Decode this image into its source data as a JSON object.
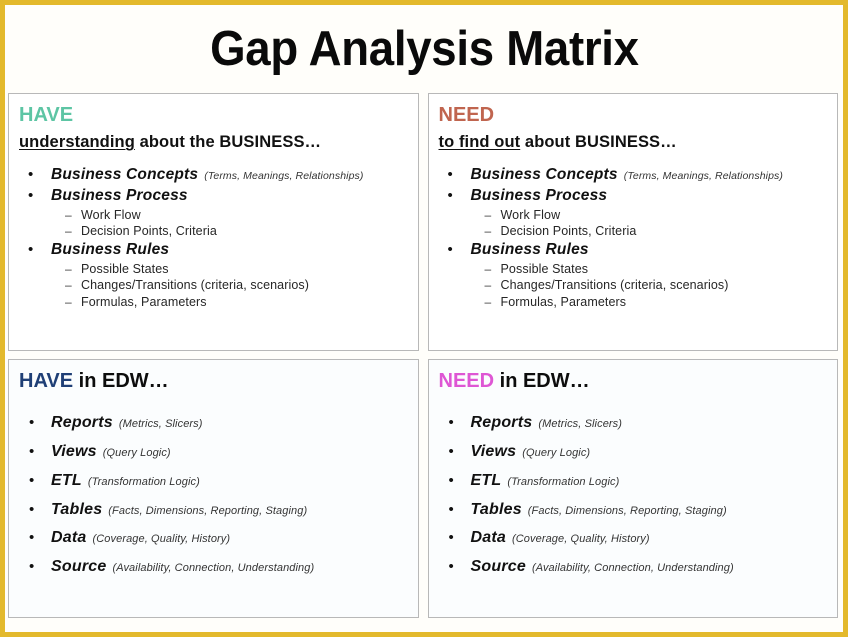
{
  "title": "Gap Analysis Matrix",
  "colors": {
    "frame": "#e3b92c",
    "have_top": "#5dc5a4",
    "need_top": "#c0654f",
    "have_edw": "#1f3f76",
    "need_edw": "#de56d4",
    "body_text": "#111111",
    "panel_border": "#b8b8b8"
  },
  "panels": {
    "have_business": {
      "keyword": "HAVE",
      "title_rest": "",
      "subtitle_underlined": "understanding",
      "subtitle_rest": "about the BUSINESS…",
      "items": [
        {
          "heading": "Business Concepts",
          "note": "(Terms,  Meanings,  Relationships)",
          "subitems": []
        },
        {
          "heading": "Business Process",
          "note": "",
          "subitems": [
            "Work Flow",
            "Decision Points, Criteria"
          ]
        },
        {
          "heading": "Business Rules",
          "note": "",
          "subitems": [
            "Possible States",
            "Changes/Transitions (criteria, scenarios)",
            "Formulas,  Parameters"
          ]
        }
      ]
    },
    "need_business": {
      "keyword": "NEED",
      "title_rest": "",
      "subtitle_underlined": "to find out",
      "subtitle_rest": "about  BUSINESS…",
      "items": [
        {
          "heading": "Business Concepts",
          "note": "(Terms,  Meanings,  Relationships)",
          "subitems": []
        },
        {
          "heading": "Business Process",
          "note": "",
          "subitems": [
            "Work Flow",
            "Decision Points, Criteria"
          ]
        },
        {
          "heading": "Business Rules",
          "note": "",
          "subitems": [
            "Possible States",
            "Changes/Transitions (criteria, scenarios)",
            "Formulas,  Parameters"
          ]
        }
      ]
    },
    "have_edw": {
      "keyword": "HAVE",
      "title_rest": " in EDW…",
      "items": [
        {
          "heading": "Reports",
          "note": "(Metrics, Slicers)"
        },
        {
          "heading": "Views",
          "note": "(Query Logic)"
        },
        {
          "heading": "ETL",
          "note": "(Transformation Logic)"
        },
        {
          "heading": "Tables",
          "note": "(Facts,  Dimensions,  Reporting, Staging)"
        },
        {
          "heading": "Data",
          "note": "(Coverage,  Quality,  History)"
        },
        {
          "heading": "Source",
          "note": "(Availability,  Connection,  Understanding)"
        }
      ]
    },
    "need_edw": {
      "keyword": "NEED",
      "title_rest": " in EDW…",
      "items": [
        {
          "heading": "Reports",
          "note": "(Metrics, Slicers)"
        },
        {
          "heading": "Views",
          "note": "(Query Logic)"
        },
        {
          "heading": "ETL",
          "note": "(Transformation Logic)"
        },
        {
          "heading": "Tables",
          "note": "(Facts,  Dimensions,  Reporting, Staging)"
        },
        {
          "heading": "Data",
          "note": "(Coverage,  Quality,  History)"
        },
        {
          "heading": "Source",
          "note": "(Availability,  Connection,  Understanding)"
        }
      ]
    }
  },
  "markers": {
    "bullet": "•",
    "dash": "–"
  }
}
